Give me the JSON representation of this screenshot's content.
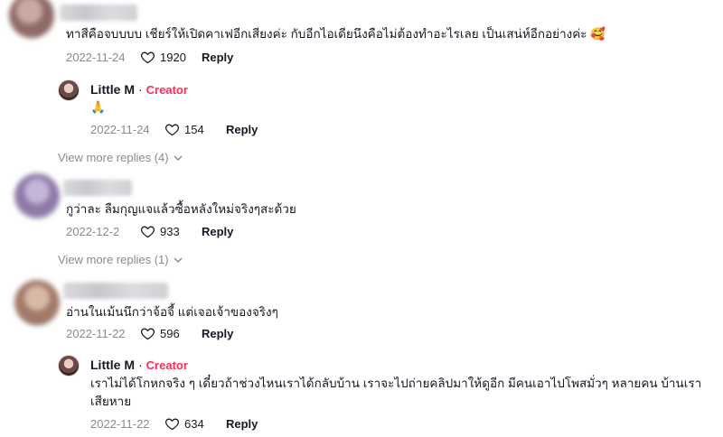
{
  "comments": [
    {
      "text": "ทาสีคือจบบบบ เชียร์ให้เปิดคาเฟอีกเสียงค่ะ กับอีกไอเดียนึงคือไม่ต้องทำอะไรเลย เป็นเสน่ห์อีกอย่างค่ะ 🥰",
      "date": "2022-11-24",
      "likes": "1920",
      "reply_label": "Reply",
      "reply": {
        "author": "Little M",
        "dot": "·",
        "badge": "Creator",
        "text": "🙏",
        "date": "2022-11-24",
        "likes": "154",
        "reply_label": "Reply"
      },
      "view_more": "View more replies (4)"
    },
    {
      "text": "กูว่าละ ลืมกุญแจแล้วซื้อหลังใหม่จริงๆสะด้วย",
      "date": "2022-12-2",
      "likes": "933",
      "reply_label": "Reply",
      "view_more": "View more replies (1)"
    },
    {
      "text": "อ่านในเม้นนึกว่าจ้อจี้ แต่เจอเจ้าของจริงๆ",
      "date": "2022-11-22",
      "likes": "596",
      "reply_label": "Reply",
      "reply": {
        "author": "Little M",
        "dot": "·",
        "badge": "Creator",
        "text_line1": "เราไม่ได้โกหกจริง ๆ เดี๋ยวถ้าช่วงไหนเราได้กลับบ้าน เราจะไปถ่ายคลิปมาให้ดูอีก มีคนเอาไปโพสมั่วๆ หลายคน บ้านเรา",
        "text_line2": "เสียหาย",
        "date": "2022-11-22",
        "likes": "634",
        "reply_label": "Reply"
      }
    }
  ],
  "colors": {
    "creator": "#fe2c55",
    "meta": "#8a8b91",
    "text": "#161823"
  },
  "icons": {
    "like": "heart-outline-icon",
    "expand": "chevron-down-icon"
  }
}
